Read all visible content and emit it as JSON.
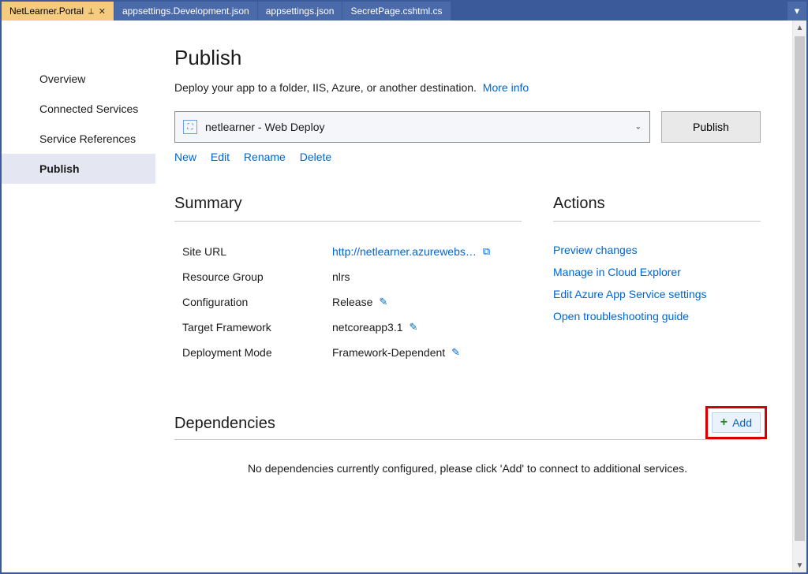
{
  "tabs": [
    {
      "label": "NetLearner.Portal",
      "active": true
    },
    {
      "label": "appsettings.Development.json",
      "active": false
    },
    {
      "label": "appsettings.json",
      "active": false
    },
    {
      "label": "SecretPage.cshtml.cs",
      "active": false
    }
  ],
  "sidebar": {
    "items": [
      {
        "label": "Overview",
        "selected": false
      },
      {
        "label": "Connected Services",
        "selected": false
      },
      {
        "label": "Service References",
        "selected": false
      },
      {
        "label": "Publish",
        "selected": true
      }
    ]
  },
  "page": {
    "title": "Publish",
    "description": "Deploy your app to a folder, IIS, Azure, or another destination.",
    "more_info": "More info"
  },
  "profile": {
    "selected_label": "netlearner - Web Deploy",
    "publish_button": "Publish",
    "links": {
      "new": "New",
      "edit": "Edit",
      "rename": "Rename",
      "delete": "Delete"
    }
  },
  "summary": {
    "heading": "Summary",
    "rows": {
      "site_url": {
        "label": "Site URL",
        "value": "http://netlearner.azurewebs…"
      },
      "resource_group": {
        "label": "Resource Group",
        "value": "nlrs"
      },
      "configuration": {
        "label": "Configuration",
        "value": "Release"
      },
      "target_framework": {
        "label": "Target Framework",
        "value": "netcoreapp3.1"
      },
      "deployment_mode": {
        "label": "Deployment Mode",
        "value": "Framework-Dependent"
      }
    }
  },
  "actions": {
    "heading": "Actions",
    "items": {
      "preview": "Preview changes",
      "manage": "Manage in Cloud Explorer",
      "edit_settings": "Edit Azure App Service settings",
      "troubleshoot": "Open troubleshooting guide"
    }
  },
  "dependencies": {
    "heading": "Dependencies",
    "add_label": "Add",
    "empty_text": "No dependencies currently configured, please click 'Add' to connect to additional services."
  }
}
